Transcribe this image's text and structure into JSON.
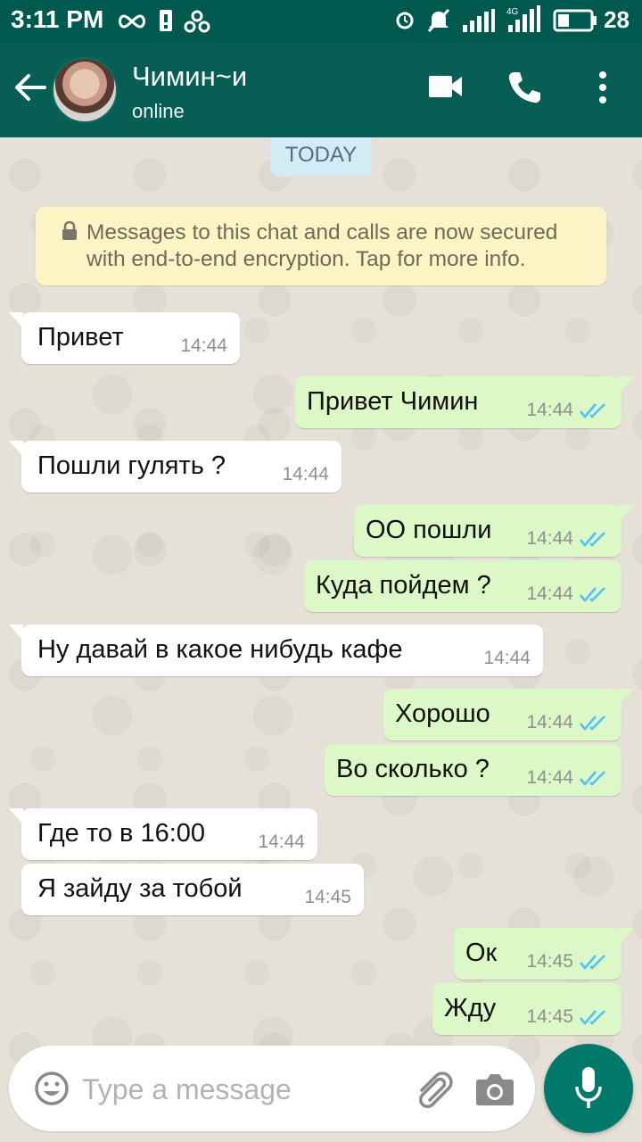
{
  "status_bar": {
    "time": "3:11 PM",
    "network_badge": "4G",
    "battery_level": "28",
    "icons": [
      "infinity-icon",
      "sim-icon",
      "trefoil-icon",
      "alarm-icon",
      "mute-icon",
      "signal-icon",
      "signal-4g-icon",
      "battery-icon"
    ]
  },
  "header": {
    "contact_name": "Чимин~и",
    "contact_status": "online",
    "icons": [
      "back-arrow-icon",
      "video-call-icon",
      "phone-call-icon",
      "more-vert-icon"
    ]
  },
  "chat": {
    "date_label": "TODAY",
    "encryption_notice": "Messages to this chat and calls are now secured with end-to-end encryption. Tap for more info.",
    "messages": [
      {
        "direction": "incoming",
        "text": "Привет",
        "time": "14:44"
      },
      {
        "direction": "outgoing",
        "text": "Привет Чимин",
        "time": "14:44",
        "status": "read"
      },
      {
        "direction": "incoming",
        "text": "Пошли гулять ?",
        "time": "14:44"
      },
      {
        "direction": "outgoing",
        "text": "ОО пошли",
        "time": "14:44",
        "status": "read"
      },
      {
        "direction": "outgoing",
        "text": "Куда пойдем ?",
        "time": "14:44",
        "status": "read"
      },
      {
        "direction": "incoming",
        "text": "Ну давай в какое нибудь кафе",
        "time": "14:44"
      },
      {
        "direction": "outgoing",
        "text": "Хорошо",
        "time": "14:44",
        "status": "read"
      },
      {
        "direction": "outgoing",
        "text": "Во сколько ?",
        "time": "14:44",
        "status": "read"
      },
      {
        "direction": "incoming",
        "text": "Где то в 16:00",
        "time": "14:44"
      },
      {
        "direction": "incoming",
        "text": "Я зайду за тобой",
        "time": "14:45"
      },
      {
        "direction": "outgoing",
        "text": "Ок",
        "time": "14:45",
        "status": "read"
      },
      {
        "direction": "outgoing",
        "text": "Жду",
        "time": "14:45",
        "status": "read"
      }
    ]
  },
  "composer": {
    "placeholder": "Type a message",
    "value": "",
    "icons": [
      "emoji-icon",
      "attach-icon",
      "camera-icon",
      "microphone-icon"
    ]
  },
  "colors": {
    "header": "#075e54",
    "status_bar": "#00594f",
    "outgoing_bubble": "#dcf8c6",
    "incoming_bubble": "#ffffff",
    "read_ticks": "#4fc3f7",
    "mic_button": "#00796b",
    "encryption_note": "#fdf4c5"
  }
}
